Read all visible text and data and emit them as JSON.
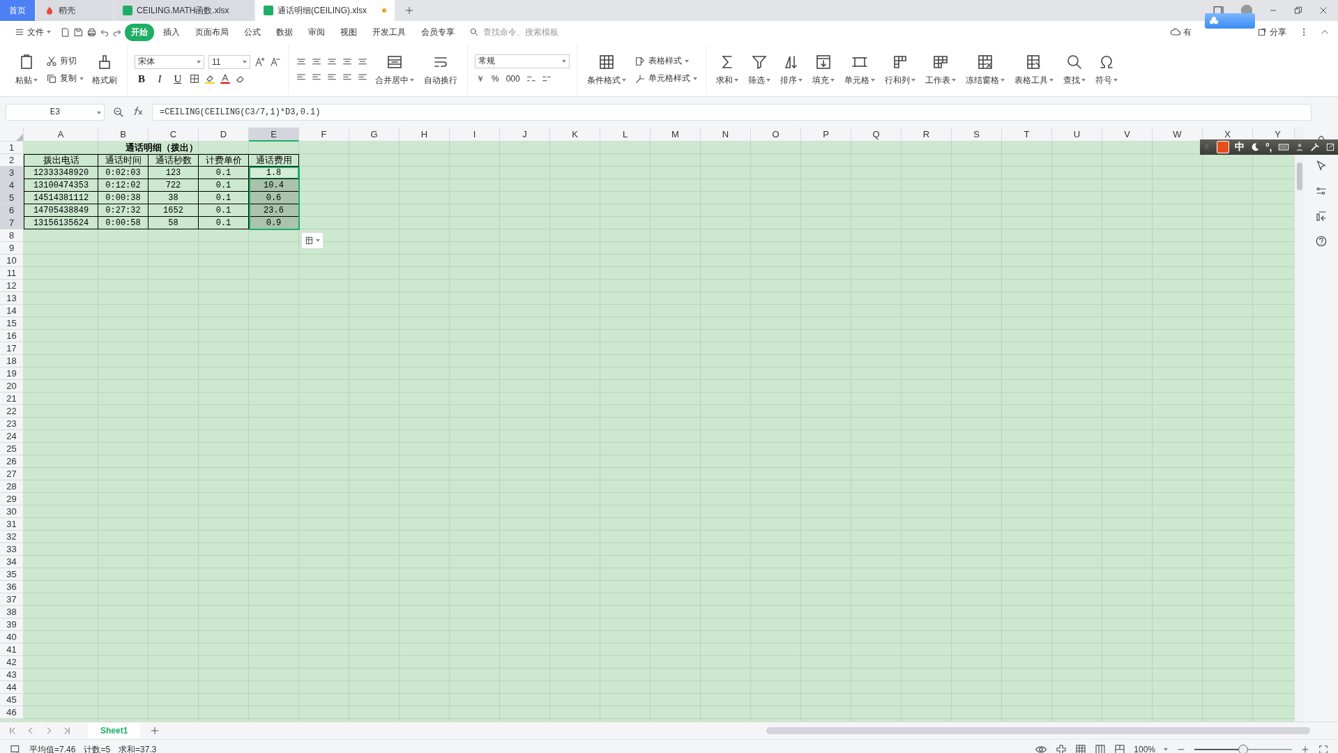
{
  "tabs": [
    {
      "label": "首页",
      "kind": "home",
      "selected": false
    },
    {
      "label": "稻壳",
      "kind": "docer",
      "selected": false
    },
    {
      "label": "CEILING.MATH函数.xlsx",
      "kind": "sheet",
      "selected": false,
      "modified": false
    },
    {
      "label": "通话明细(CEILING).xlsx",
      "kind": "sheet",
      "selected": true,
      "modified": true
    }
  ],
  "menu": {
    "file": "文件",
    "tabs": [
      {
        "label": "开始",
        "selected": true
      },
      {
        "label": "插入",
        "selected": false
      },
      {
        "label": "页面布局",
        "selected": false
      },
      {
        "label": "公式",
        "selected": false
      },
      {
        "label": "数据",
        "selected": false
      },
      {
        "label": "审阅",
        "selected": false
      },
      {
        "label": "视图",
        "selected": false
      },
      {
        "label": "开发工具",
        "selected": false
      },
      {
        "label": "会员专享",
        "selected": false
      }
    ],
    "search_placeholder": "查找命令、搜索模板",
    "sync": "有",
    "share": "分享"
  },
  "ribbon": {
    "paste": "粘贴",
    "cut": "剪切",
    "copy": "复制",
    "format_painter": "格式刷",
    "font": "宋体",
    "size": "11",
    "styles": [
      "B",
      "I",
      "U"
    ],
    "merge": "合并居中",
    "wrap": "自动换行",
    "number_format": "常规",
    "number_symbols": [
      "￥",
      "%",
      "000"
    ],
    "table_style": "表格样式",
    "cond_format": "条件格式",
    "cell_style": "单元格样式",
    "tools": [
      "求和",
      "筛选",
      "排序",
      "填充",
      "单元格",
      "行和列",
      "工作表",
      "冻结窗格",
      "表格工具",
      "查找",
      "符号"
    ]
  },
  "formula_bar": {
    "name_box": "E3",
    "formula": "=CEILING(CEILING(C3/7,1)*D3,0.1)"
  },
  "columns": [
    {
      "label": "A",
      "selected": false
    },
    {
      "label": "B",
      "selected": false
    },
    {
      "label": "C",
      "selected": false
    },
    {
      "label": "D",
      "selected": false
    },
    {
      "label": "E",
      "selected": true
    },
    {
      "label": "F",
      "selected": false
    },
    {
      "label": "G",
      "selected": false
    },
    {
      "label": "H",
      "selected": false
    },
    {
      "label": "I",
      "selected": false
    },
    {
      "label": "J",
      "selected": false
    },
    {
      "label": "K",
      "selected": false
    },
    {
      "label": "L",
      "selected": false
    },
    {
      "label": "M",
      "selected": false
    },
    {
      "label": "N",
      "selected": false
    },
    {
      "label": "O",
      "selected": false
    },
    {
      "label": "P",
      "selected": false
    },
    {
      "label": "Q",
      "selected": false
    },
    {
      "label": "R",
      "selected": false
    },
    {
      "label": "S",
      "selected": false
    },
    {
      "label": "T",
      "selected": false
    },
    {
      "label": "U",
      "selected": false
    },
    {
      "label": "V",
      "selected": false
    },
    {
      "label": "W",
      "selected": false
    },
    {
      "label": "X",
      "selected": false
    },
    {
      "label": "Y",
      "selected": false
    }
  ],
  "row_numbers": [
    {
      "label": "1",
      "selected": false
    },
    {
      "label": "2",
      "selected": false
    },
    {
      "label": "3",
      "selected": true
    },
    {
      "label": "4",
      "selected": true
    },
    {
      "label": "5",
      "selected": true
    },
    {
      "label": "6",
      "selected": true
    },
    {
      "label": "7",
      "selected": true
    },
    {
      "label": "8",
      "selected": false
    },
    {
      "label": "9",
      "selected": false
    },
    {
      "label": "10",
      "selected": false
    },
    {
      "label": "11",
      "selected": false
    },
    {
      "label": "12",
      "selected": false
    },
    {
      "label": "13",
      "selected": false
    },
    {
      "label": "14",
      "selected": false
    },
    {
      "label": "15",
      "selected": false
    },
    {
      "label": "16",
      "selected": false
    },
    {
      "label": "17",
      "selected": false
    },
    {
      "label": "18",
      "selected": false
    },
    {
      "label": "19",
      "selected": false
    },
    {
      "label": "20",
      "selected": false
    },
    {
      "label": "21",
      "selected": false
    },
    {
      "label": "22",
      "selected": false
    },
    {
      "label": "23",
      "selected": false
    },
    {
      "label": "24",
      "selected": false
    },
    {
      "label": "25",
      "selected": false
    },
    {
      "label": "26",
      "selected": false
    },
    {
      "label": "27",
      "selected": false
    },
    {
      "label": "28",
      "selected": false
    },
    {
      "label": "29",
      "selected": false
    },
    {
      "label": "30",
      "selected": false
    },
    {
      "label": "31",
      "selected": false
    },
    {
      "label": "32",
      "selected": false
    },
    {
      "label": "33",
      "selected": false
    },
    {
      "label": "34",
      "selected": false
    },
    {
      "label": "35",
      "selected": false
    },
    {
      "label": "36",
      "selected": false
    },
    {
      "label": "37",
      "selected": false
    },
    {
      "label": "38",
      "selected": false
    },
    {
      "label": "39",
      "selected": false
    },
    {
      "label": "40",
      "selected": false
    },
    {
      "label": "41",
      "selected": false
    },
    {
      "label": "42",
      "selected": false
    },
    {
      "label": "43",
      "selected": false
    },
    {
      "label": "44",
      "selected": false
    },
    {
      "label": "45",
      "selected": false
    },
    {
      "label": "46",
      "selected": false
    }
  ],
  "table": {
    "title": "通话明细（拨出）",
    "rows": [
      {
        "cells": [
          {
            "text": "拨出电话",
            "selected": false,
            "active": false
          },
          {
            "text": "通话时间",
            "selected": false,
            "active": false
          },
          {
            "text": "通话秒数",
            "selected": false,
            "active": false
          },
          {
            "text": "计费单价",
            "selected": false,
            "active": false
          },
          {
            "text": "通话费用",
            "selected": false,
            "active": false
          }
        ]
      },
      {
        "cells": [
          {
            "text": "12333348920",
            "selected": false,
            "active": false
          },
          {
            "text": "0:02:03",
            "selected": false,
            "active": false
          },
          {
            "text": "123",
            "selected": false,
            "active": false
          },
          {
            "text": "0.1",
            "selected": false,
            "active": false
          },
          {
            "text": "1.8",
            "selected": true,
            "active": true
          }
        ]
      },
      {
        "cells": [
          {
            "text": "13100474353",
            "selected": false,
            "active": false
          },
          {
            "text": "0:12:02",
            "selected": false,
            "active": false
          },
          {
            "text": "722",
            "selected": false,
            "active": false
          },
          {
            "text": "0.1",
            "selected": false,
            "active": false
          },
          {
            "text": "10.4",
            "selected": true,
            "active": false
          }
        ]
      },
      {
        "cells": [
          {
            "text": "14514381112",
            "selected": false,
            "active": false
          },
          {
            "text": "0:00:38",
            "selected": false,
            "active": false
          },
          {
            "text": "38",
            "selected": false,
            "active": false
          },
          {
            "text": "0.1",
            "selected": false,
            "active": false
          },
          {
            "text": "0.6",
            "selected": true,
            "active": false
          }
        ]
      },
      {
        "cells": [
          {
            "text": "14705438849",
            "selected": false,
            "active": false
          },
          {
            "text": "0:27:32",
            "selected": false,
            "active": false
          },
          {
            "text": "1652",
            "selected": false,
            "active": false
          },
          {
            "text": "0.1",
            "selected": false,
            "active": false
          },
          {
            "text": "23.6",
            "selected": true,
            "active": false
          }
        ]
      },
      {
        "cells": [
          {
            "text": "13156135624",
            "selected": false,
            "active": false
          },
          {
            "text": "0:00:58",
            "selected": false,
            "active": false
          },
          {
            "text": "58",
            "selected": false,
            "active": false
          },
          {
            "text": "0.1",
            "selected": false,
            "active": false
          },
          {
            "text": "0.9",
            "selected": true,
            "active": false
          }
        ]
      }
    ]
  },
  "ime": {
    "mode": "中",
    "punct": "°,"
  },
  "sheets": [
    {
      "label": "Sheet1",
      "selected": true
    }
  ],
  "status": {
    "items": [
      "平均值=7.46",
      "计数=5",
      "求和=37.3"
    ],
    "zoom": "100%",
    "zoom_level": {
      "level": 0.5
    }
  }
}
